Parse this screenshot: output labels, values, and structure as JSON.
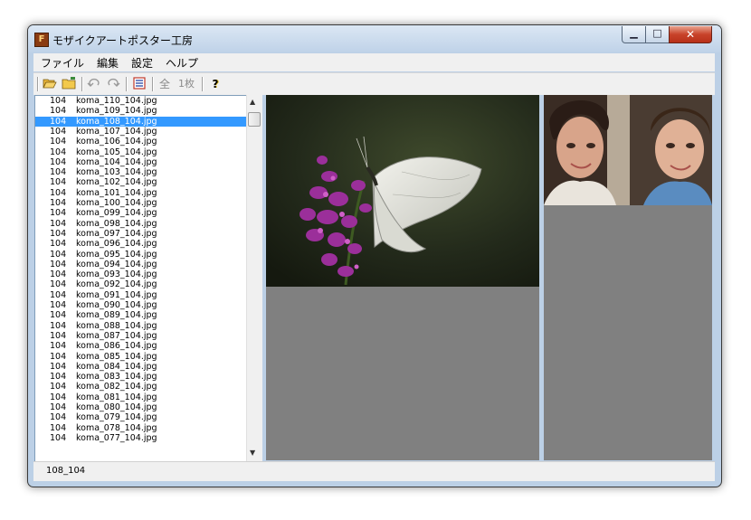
{
  "window": {
    "title": "モザイクアートポスター工房"
  },
  "menu": {
    "items": [
      "ファイル",
      "編集",
      "設定",
      "ヘルプ"
    ]
  },
  "toolbar": {
    "all_label": "全",
    "one_label": "1枚",
    "help_label": "?"
  },
  "file_list": {
    "items": [
      {
        "num": "104",
        "name": "koma_110_104.jpg"
      },
      {
        "num": "104",
        "name": "koma_109_104.jpg"
      },
      {
        "num": "104",
        "name": "koma_108_104.jpg",
        "selected": true
      },
      {
        "num": "104",
        "name": "koma_107_104.jpg"
      },
      {
        "num": "104",
        "name": "koma_106_104.jpg"
      },
      {
        "num": "104",
        "name": "koma_105_104.jpg"
      },
      {
        "num": "104",
        "name": "koma_104_104.jpg"
      },
      {
        "num": "104",
        "name": "koma_103_104.jpg"
      },
      {
        "num": "104",
        "name": "koma_102_104.jpg"
      },
      {
        "num": "104",
        "name": "koma_101_104.jpg"
      },
      {
        "num": "104",
        "name": "koma_100_104.jpg"
      },
      {
        "num": "104",
        "name": "koma_099_104.jpg"
      },
      {
        "num": "104",
        "name": "koma_098_104.jpg"
      },
      {
        "num": "104",
        "name": "koma_097_104.jpg"
      },
      {
        "num": "104",
        "name": "koma_096_104.jpg"
      },
      {
        "num": "104",
        "name": "koma_095_104.jpg"
      },
      {
        "num": "104",
        "name": "koma_094_104.jpg"
      },
      {
        "num": "104",
        "name": "koma_093_104.jpg"
      },
      {
        "num": "104",
        "name": "koma_092_104.jpg"
      },
      {
        "num": "104",
        "name": "koma_091_104.jpg"
      },
      {
        "num": "104",
        "name": "koma_090_104.jpg"
      },
      {
        "num": "104",
        "name": "koma_089_104.jpg"
      },
      {
        "num": "104",
        "name": "koma_088_104.jpg"
      },
      {
        "num": "104",
        "name": "koma_087_104.jpg"
      },
      {
        "num": "104",
        "name": "koma_086_104.jpg"
      },
      {
        "num": "104",
        "name": "koma_085_104.jpg"
      },
      {
        "num": "104",
        "name": "koma_084_104.jpg"
      },
      {
        "num": "104",
        "name": "koma_083_104.jpg"
      },
      {
        "num": "104",
        "name": "koma_082_104.jpg"
      },
      {
        "num": "104",
        "name": "koma_081_104.jpg"
      },
      {
        "num": "104",
        "name": "koma_080_104.jpg"
      },
      {
        "num": "104",
        "name": "koma_079_104.jpg"
      },
      {
        "num": "104",
        "name": "koma_078_104.jpg"
      },
      {
        "num": "104",
        "name": "koma_077_104.jpg"
      }
    ]
  },
  "status": {
    "text": "108_104"
  },
  "colors": {
    "selection": "#3399ff",
    "pane_background": "#808080"
  }
}
